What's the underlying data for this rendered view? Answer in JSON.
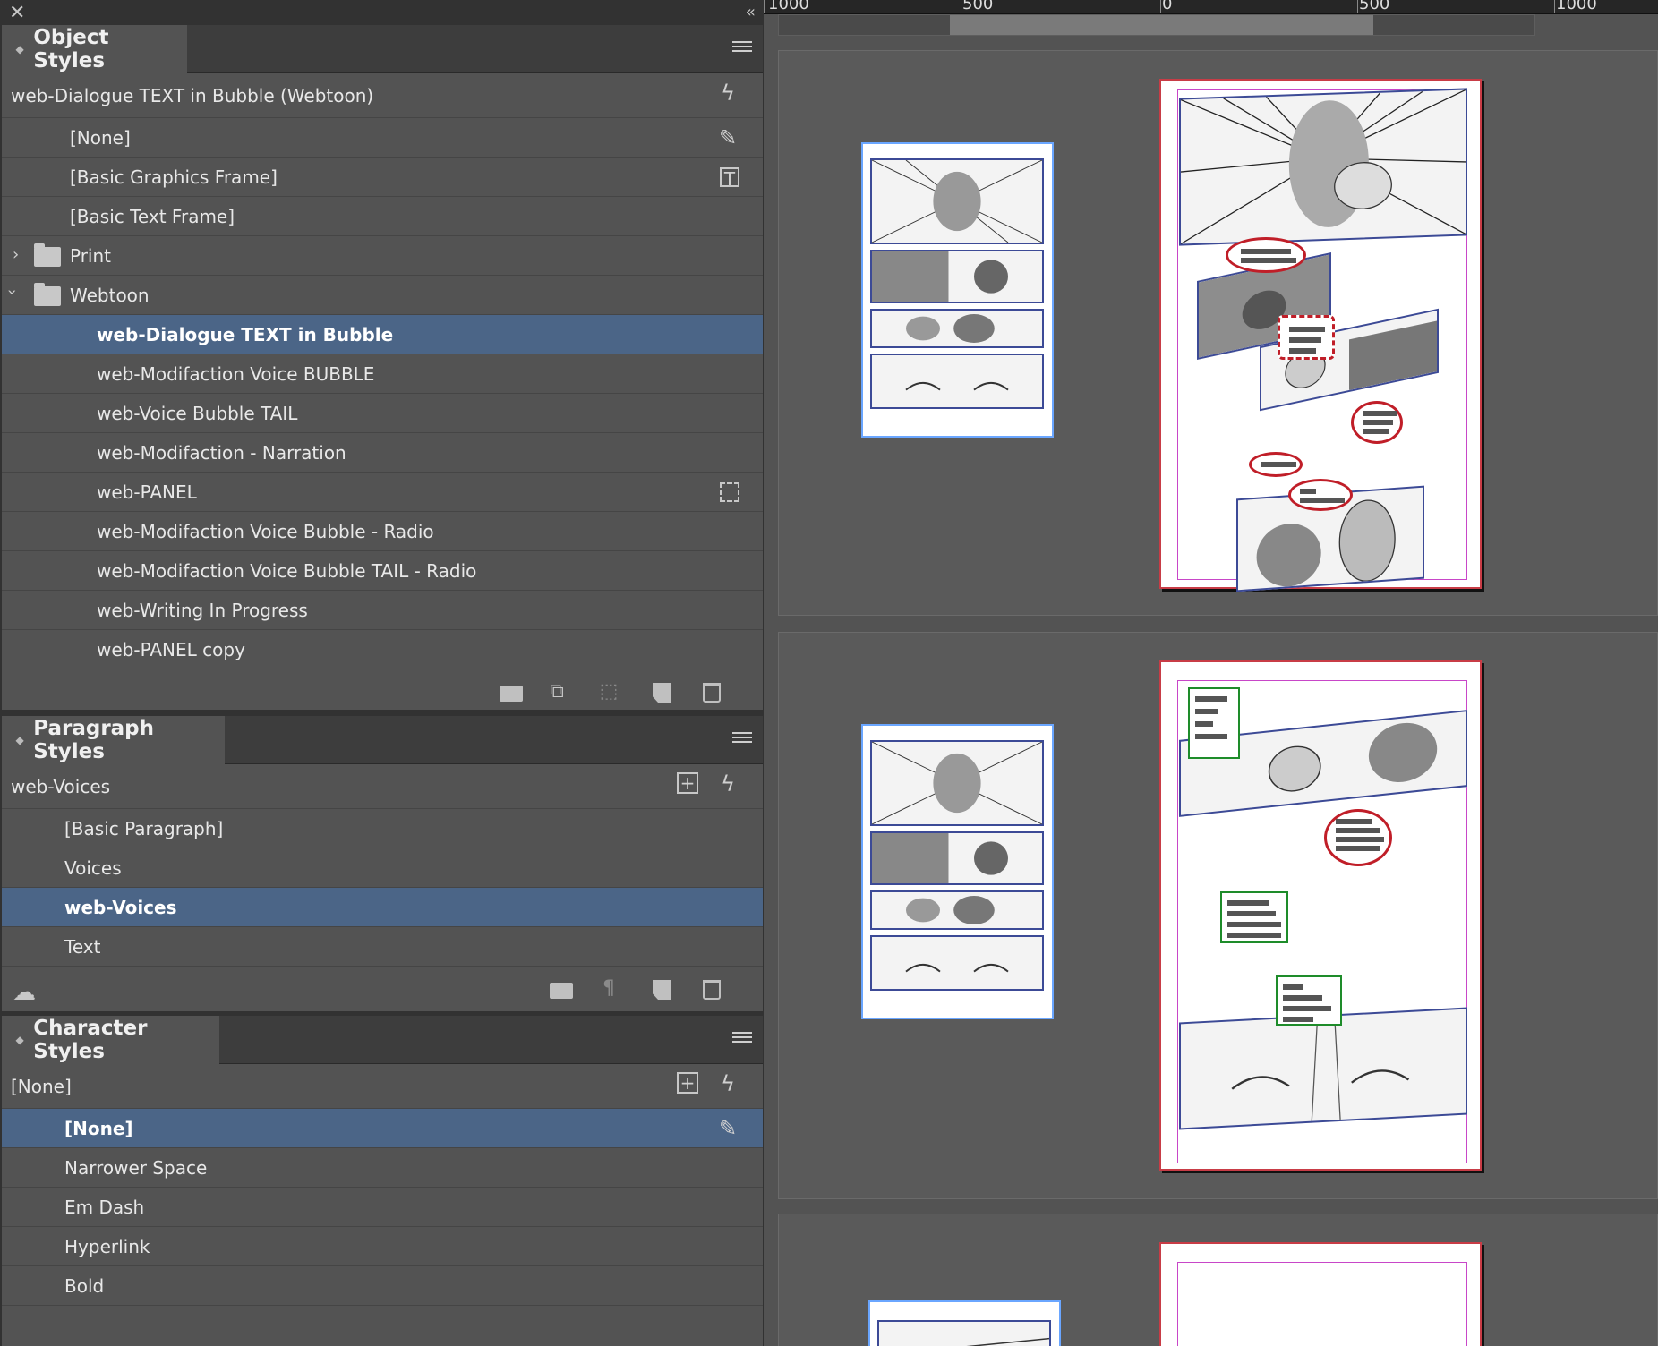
{
  "object_styles": {
    "tab_title": "Object Styles",
    "current_style": "web-Dialogue TEXT in Bubble (Webtoon)",
    "items": [
      {
        "label": "[None]",
        "indent": 1,
        "icon": "pen-slash-icon"
      },
      {
        "label": "[Basic Graphics Frame]",
        "indent": 1,
        "icon": "graphics-frame-icon"
      },
      {
        "label": "[Basic Text Frame]",
        "indent": 1
      },
      {
        "label": "Print",
        "group": "collapsed"
      },
      {
        "label": "Webtoon",
        "group": "expanded"
      },
      {
        "label": "web-Dialogue TEXT in Bubble",
        "indent": 2,
        "selected": true
      },
      {
        "label": "web-Modifaction Voice BUBBLE",
        "indent": 2
      },
      {
        "label": "web-Voice Bubble TAIL",
        "indent": 2
      },
      {
        "label": "web-Modifaction - Narration",
        "indent": 2
      },
      {
        "label": "web-PANEL",
        "indent": 2,
        "icon": "frame-fitting-icon"
      },
      {
        "label": "web-Modifaction Voice Bubble - Radio",
        "indent": 2
      },
      {
        "label": "web-Modifaction Voice Bubble TAIL - Radio",
        "indent": 2
      },
      {
        "label": "web-Writing In Progress",
        "indent": 2
      },
      {
        "label": "web-PANEL copy",
        "indent": 2
      }
    ]
  },
  "paragraph_styles": {
    "tab_title": "Paragraph Styles",
    "current_style": "web-Voices",
    "items": [
      {
        "label": "[Basic Paragraph]"
      },
      {
        "label": "Voices"
      },
      {
        "label": "web-Voices",
        "selected": true
      },
      {
        "label": "Text"
      }
    ]
  },
  "character_styles": {
    "tab_title": "Character Styles",
    "current_style": "[None]",
    "items": [
      {
        "label": "[None]",
        "selected": true,
        "icon": "pen-slash-icon"
      },
      {
        "label": "Narrower Space"
      },
      {
        "label": "Em Dash"
      },
      {
        "label": "Hyperlink"
      },
      {
        "label": "Bold"
      }
    ]
  },
  "ruler": {
    "labels": [
      "1000",
      "500",
      "0",
      "500",
      "1000"
    ]
  },
  "colors": {
    "selection": "#4b6587",
    "panel_bg": "#535353",
    "page_border": "#c83c46",
    "margin_guide": "#c846c8",
    "bubble_stroke": "#c01e28",
    "narration_stroke": "#1e8c2a"
  }
}
